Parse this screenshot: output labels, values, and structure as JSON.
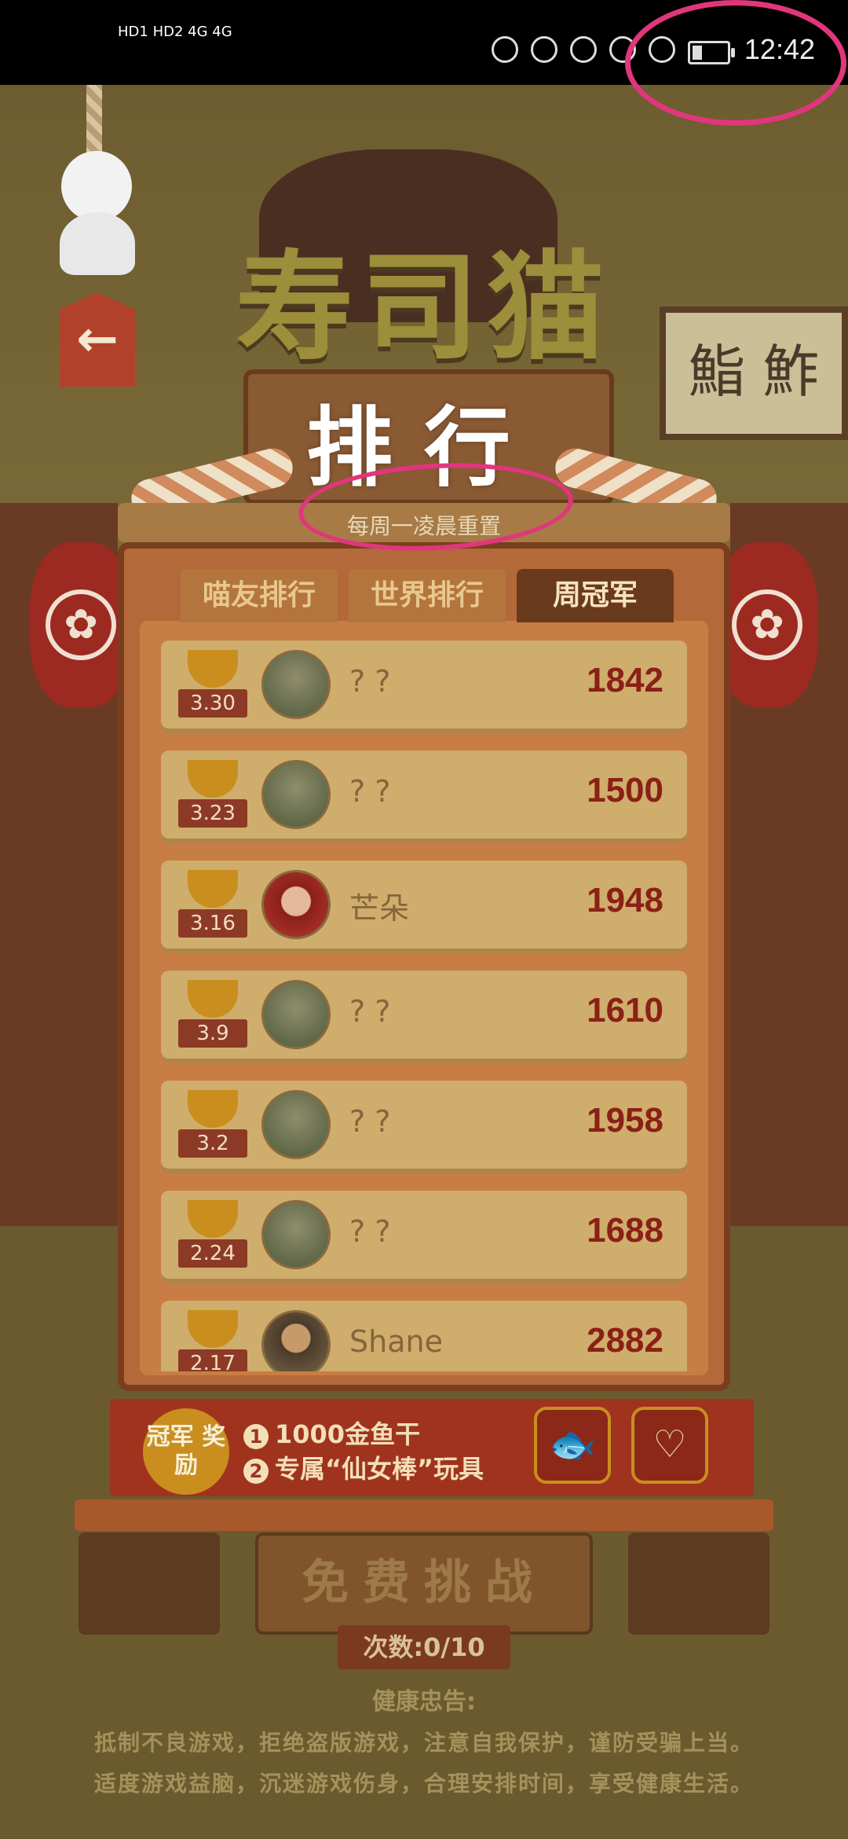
{
  "status_bar": {
    "time": "12:42",
    "network": "HD1 HD2 4G 4G"
  },
  "back_button": {
    "arrow": "←"
  },
  "title": {
    "main": "寿司猫",
    "sub": "排行",
    "reset_note": "每周一凌晨重置"
  },
  "background_sign": "鮨 鮓",
  "tabs": [
    {
      "label": "喵友排行",
      "active": false
    },
    {
      "label": "世界排行",
      "active": false
    },
    {
      "label": "周冠军",
      "active": true
    }
  ],
  "rows": [
    {
      "date": "3.30",
      "name": "? ?",
      "score": "1842"
    },
    {
      "date": "3.23",
      "name": "? ?",
      "score": "1500"
    },
    {
      "date": "3.16",
      "name": "芒朵",
      "score": "1948"
    },
    {
      "date": "3.9",
      "name": "? ?",
      "score": "1610"
    },
    {
      "date": "3.2",
      "name": "? ?",
      "score": "1958"
    },
    {
      "date": "2.24",
      "name": "? ?",
      "score": "1688"
    },
    {
      "date": "2.17",
      "name": "Shane",
      "score": "2882"
    }
  ],
  "reward": {
    "badge": "冠军 奖励",
    "item1_num": "1",
    "item1": "1000金鱼干",
    "item2_num": "2",
    "item2": "专属“仙女棒”玩具"
  },
  "challenge_button": "免费挑战",
  "count": "次数:0/10",
  "health": {
    "title": "健康忠告:",
    "line1": "抵制不良游戏，拒绝盗版游戏，注意自我保护，谨防受骗上当。",
    "line2": "适度游戏益脑，沉迷游戏伤身，合理安排时间，享受健康生活。"
  },
  "colors": {
    "annotation": "#e0367d",
    "score": "#8a2016",
    "active_tab": "#6a3a1c"
  }
}
